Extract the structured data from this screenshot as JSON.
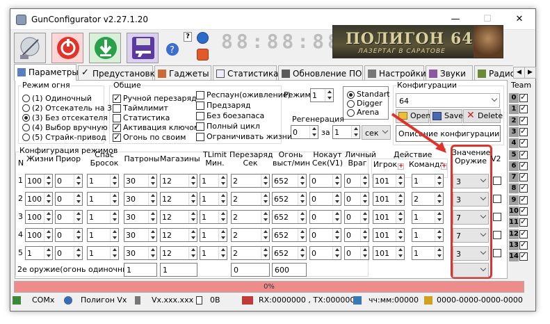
{
  "window": {
    "title": "GunConfigurator v2.27.1.20",
    "min": "—",
    "max": "☐",
    "close": "✕"
  },
  "toolbar": {
    "clock": "88:88:88",
    "help": "?"
  },
  "banner": {
    "title": "ПОЛИГОН 64",
    "subtitle": "ЛАЗЕРТАГ В САРАТОВЕ"
  },
  "tabs": [
    "Параметры",
    "Предустановки",
    "Гаджеты",
    "Статистика",
    "Обновление ПО",
    "Настройки",
    "Звуки",
    "Радио"
  ],
  "fire_mode": {
    "title": "Режим огня",
    "options": [
      "(1) Одиночный",
      "(2) Отсекатель на 3",
      "(3) Без отсекателя",
      "(4) Выбор вручную",
      "(5) Страйк-привод"
    ],
    "selected": 2
  },
  "general": {
    "title": "Общие",
    "checks": [
      {
        "label": "Ручной перезаряд",
        "on": true
      },
      {
        "label": "Таймлимит",
        "on": false
      },
      {
        "label": "Статистика",
        "on": false
      },
      {
        "label": "Активация ключом",
        "on": true
      },
      {
        "label": "Огонь по своим",
        "on": true
      }
    ],
    "checks2": [
      {
        "label": "Респаун(оживление)",
        "on": false
      },
      {
        "label": "Предзаряд",
        "on": false
      },
      {
        "label": "Без боезапаса",
        "on": false
      },
      {
        "label": "Полный цикл",
        "on": false
      },
      {
        "label": "Ограничивать жизни",
        "on": false
      }
    ],
    "mode_label": "Режим",
    "mode_value": "1"
  },
  "preset": {
    "options": [
      "Standart",
      "Digger",
      "Arena"
    ],
    "selected": 0
  },
  "regen": {
    "title": "Регенерация",
    "value": "0",
    "per": "за",
    "period": "1",
    "unit": "сек"
  },
  "configs": {
    "title": "Конфигурации",
    "value": "64",
    "open": "Open",
    "save": "Save",
    "delete": "Delete",
    "description": "Описание конфигурации"
  },
  "team": {
    "title": "Team",
    "rows": [
      "0",
      "1",
      "2",
      "3",
      "4",
      "5",
      "6",
      "7",
      "8",
      "9",
      "10",
      "11",
      "12",
      "13",
      "14"
    ]
  },
  "modes_table": {
    "title": "Конфигурация режимов",
    "headers": {
      "n": "N",
      "lives": "Жизни",
      "prior": "Приор",
      "rescue": "Спас\nБросок",
      "ammo": "Патроны",
      "mags": "Магазины",
      "tlimit": "TLimit\nМин.",
      "reload": "Перезаряд\nСек",
      "fire": "Огонь\nвыст/мин",
      "knockout": "Нокаут\nСек(V1)",
      "personal": "Личный\nВраг",
      "action": "Действие",
      "player": "Игрок",
      "command": "Команда",
      "value": "Значение\nОружие",
      "v2": "V2"
    },
    "rows": [
      {
        "n": "1",
        "lives": "100",
        "prior": "0",
        "rescue": "1",
        "ammo": "30",
        "mags": "12",
        "tlimit": "1",
        "reload": "2",
        "fire": "652",
        "ko": "0",
        "pers": "0",
        "player": "101",
        "command": "1",
        "value": "3"
      },
      {
        "n": "2",
        "lives": "100",
        "prior": "0",
        "rescue": "1",
        "ammo": "30",
        "mags": "12",
        "tlimit": "1",
        "reload": "2",
        "fire": "652",
        "ko": "0",
        "pers": "0",
        "player": "101",
        "command": "2",
        "value": "3"
      },
      {
        "n": "3",
        "lives": "100",
        "prior": "0",
        "rescue": "1",
        "ammo": "30",
        "mags": "12",
        "tlimit": "1",
        "reload": "2",
        "fire": "652",
        "ko": "0",
        "pers": "0",
        "player": "101",
        "command": "1",
        "value": "7"
      },
      {
        "n": "4",
        "lives": "100",
        "prior": "0",
        "rescue": "1",
        "ammo": "30",
        "mags": "12",
        "tlimit": "1",
        "reload": "2",
        "fire": "652",
        "ko": "0",
        "pers": "0",
        "player": "101",
        "command": "1",
        "value": "7"
      },
      {
        "n": "5",
        "lives": "1",
        "prior": "0",
        "rescue": "1",
        "ammo": "30",
        "mags": "12",
        "tlimit": "1",
        "reload": "2",
        "fire": "652",
        "ko": "0",
        "pers": "0",
        "player": "101",
        "command": "1",
        "value": "3"
      }
    ],
    "second_weapon": {
      "label": "2е оружие(огонь одиночными)",
      "rescue": "1",
      "ammo": "1",
      "reload": "0",
      "fire": "600"
    }
  },
  "progress": {
    "label": "0%",
    "fraction": 0
  },
  "status": {
    "port": "COMx",
    "device": "Полигон Vx",
    "version": "Vx.xxx.xxx",
    "voltage": "0В",
    "rxtx": "RX:0000000 , TX:0000000",
    "time": "чч:мм:00000",
    "key": "0000-0000-0000-0000"
  }
}
